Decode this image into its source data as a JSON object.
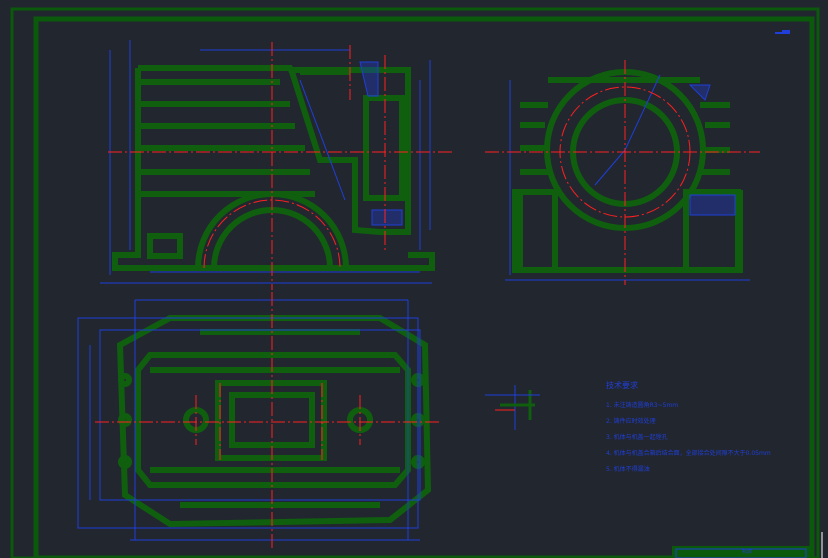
{
  "tech_requirements": {
    "title": "技术要求",
    "items": [
      "1. 未注铸造圆角R3~5mm",
      "2. 铸件应时效处理",
      "3. 机体与机盖一起镗孔",
      "4. 机体与机盖合箱后结合面，全部接合处间隙不大于0.05mm",
      "5. 机体不得漏油"
    ]
  },
  "title_block": {
    "label": "机体"
  },
  "colors": {
    "background": "#22262f",
    "frame": "#0b5a0b",
    "outline": "#0f5f0f",
    "centerline": "#ff2020",
    "dimension": "#1f3fd8"
  }
}
